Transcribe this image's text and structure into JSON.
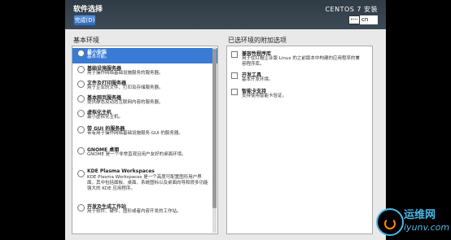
{
  "header": {
    "title": "软件选择",
    "done_label": "完成(D)",
    "product": "CENTOS 7 安装",
    "keyboard_layout": "cn"
  },
  "left": {
    "heading": "基本环境",
    "items": [
      {
        "name": "最小安装",
        "desc": "基本功能。",
        "selected": true
      },
      {
        "name": "基础设施服务器",
        "desc": "用于操作网络基础设施服务的服务器。",
        "selected": false
      },
      {
        "name": "文件及打印服务器",
        "desc": "用于企业的文件、打印及存储服务器。",
        "selected": false
      },
      {
        "name": "基本网页服务器",
        "desc": "提供静态及动态互联网内容的服务器。",
        "selected": false
      },
      {
        "name": "虚拟化主机",
        "desc": "最小虚拟化主机。",
        "selected": false
      },
      {
        "name": "带 GUI 的服务器",
        "desc": "带有用于操作网络基础设施服务 GUI 的服务器。",
        "selected": false
      },
      {
        "name": "GNOME 桌面",
        "desc": "GNOME 是一个非常直观且用户友好的桌面环境。",
        "selected": false
      },
      {
        "name": "KDE Plasma Workspaces",
        "desc": "KDE Plasma Workspaces 是一个高度可配置图形用户界面，其中包括面板、桌面、系统图标以及桌面向导和很多功能强大的 KDE 应用程序。",
        "selected": false
      },
      {
        "name": "开发及生成工作站",
        "desc": "用于软件、硬件、图形或者内容开发的工作站。",
        "selected": false
      }
    ]
  },
  "right": {
    "heading": "已选环境的附加选项",
    "items": [
      {
        "name": "兼容性程序库",
        "desc": "用于在红帽企业版 Linux 的之前版本中构建的应用程序的兼容程序库。"
      },
      {
        "name": "开发工具",
        "desc": "基本开发环境。"
      },
      {
        "name": "智能卡支持",
        "desc": "支持使用智能卡验证。"
      }
    ]
  },
  "watermark": {
    "line1": "运维网",
    "line2": "iyunv.com"
  }
}
